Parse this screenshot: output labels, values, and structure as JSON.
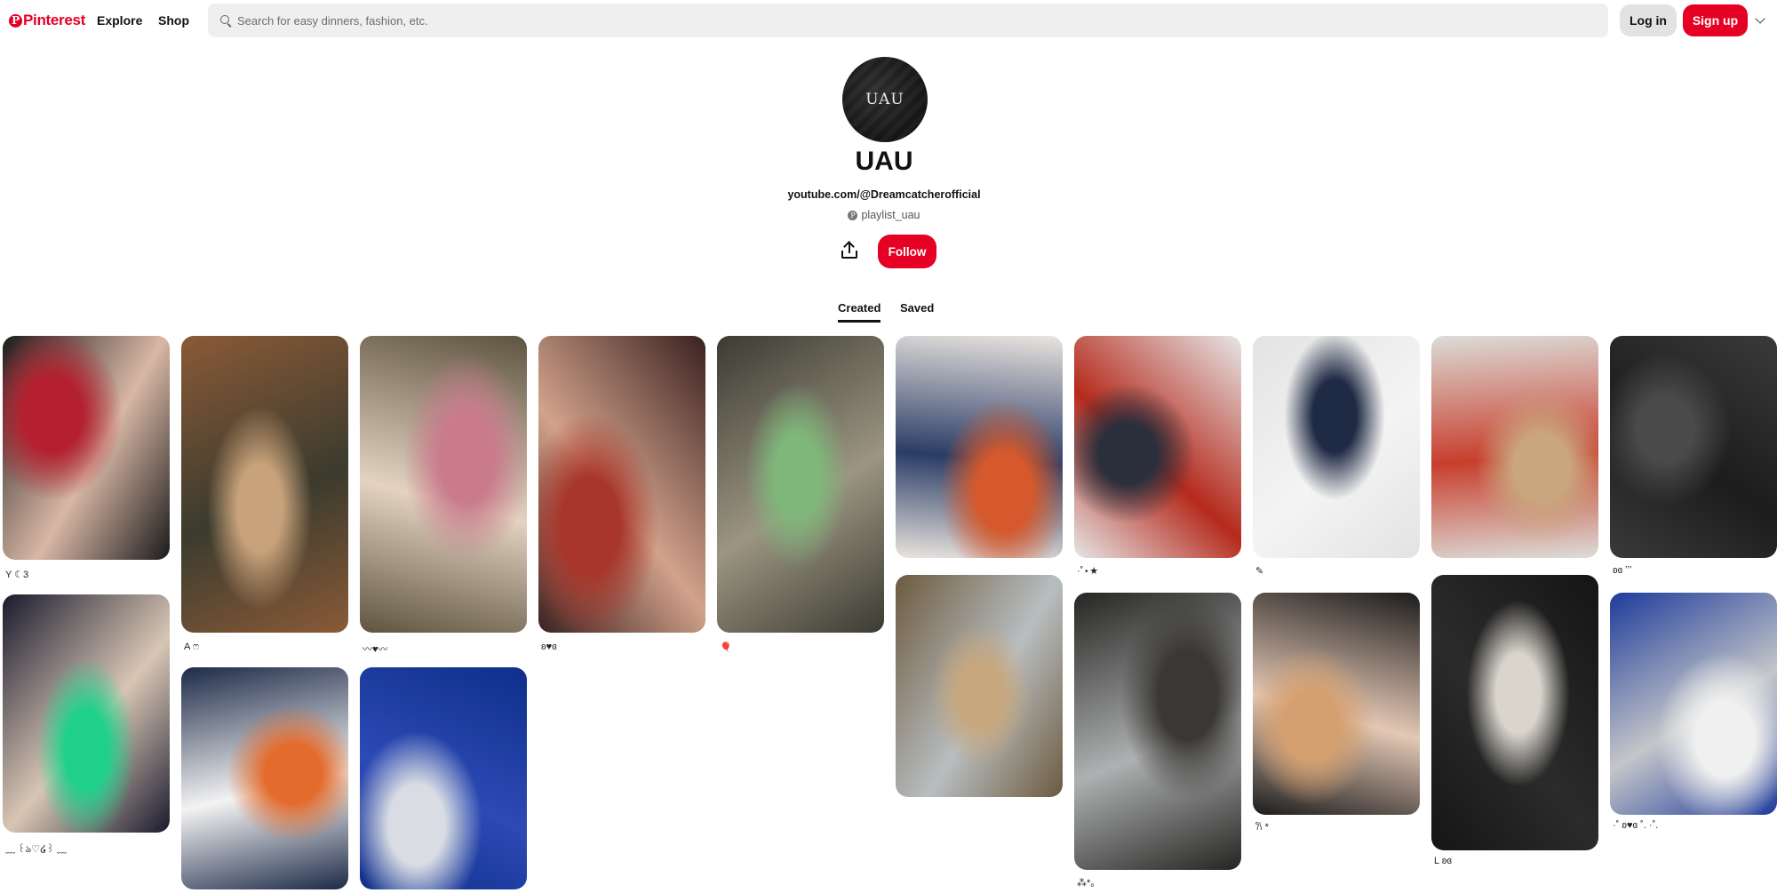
{
  "header": {
    "logo_text": "Pinterest",
    "logo_mark": "P",
    "nav": [
      "Explore",
      "Shop"
    ],
    "search_placeholder": "Search for easy dinners, fashion, etc.",
    "login_label": "Log in",
    "signup_label": "Sign up",
    "brand_color": "#e60023"
  },
  "profile": {
    "avatar_text": "UAU",
    "name": "UAU",
    "website": "youtube.com/@Dreamcatcherofficial",
    "handle": "playlist_uau",
    "follow_label": "Follow"
  },
  "tabs": [
    {
      "label": "Created",
      "active": true
    },
    {
      "label": "Saved",
      "active": false
    }
  ],
  "pins": [
    {
      "caption": "Y ☾3",
      "colors": [
        "#1b1b1b",
        "#b4202f",
        "#d8b7a5"
      ]
    },
    {
      "caption": "A ෆ",
      "colors": [
        "#8a5a37",
        "#c8a27a",
        "#3b3b2e"
      ]
    },
    {
      "caption": "〰♥〰",
      "colors": [
        "#5e5440",
        "#c97b8c",
        "#e3d3c0"
      ]
    },
    {
      "caption": "ʚ♥ɞ",
      "colors": [
        "#3a2120",
        "#a8362b",
        "#d2a28b"
      ]
    },
    {
      "caption": "🎈",
      "colors": [
        "#3c3b33",
        "#7fb77a",
        "#9b9581"
      ]
    },
    {
      "caption": "",
      "colors": [
        "#e9e4df",
        "#d5592c",
        "#2a3c66"
      ]
    },
    {
      "caption": "·˚⋆★",
      "colors": [
        "#e6e6e6",
        "#2b2f3c",
        "#b52a1c"
      ]
    },
    {
      "caption": "✎",
      "colors": [
        "#e3e3e3",
        "#1f2a44",
        "#f4f4f4"
      ]
    },
    {
      "caption": "",
      "colors": [
        "#dcdcd8",
        "#c9a67e",
        "#c83e2c"
      ]
    },
    {
      "caption": "ʚɞ ʼʼʼ",
      "colors": [
        "#3a3a3a",
        "#4a4a4a",
        "#1c1c1c"
      ]
    },
    {
      "caption": "﹏ ꒰ঌ♡໒꒱ ﹏",
      "colors": [
        "#1a1a2e",
        "#1fd08b",
        "#d8c6b4"
      ]
    },
    {
      "caption": "",
      "colors": [
        "#1d2a48",
        "#e36b2d",
        "#f3f3f3"
      ]
    },
    {
      "caption": "",
      "colors": [
        "#0e2f8a",
        "#d9dde3",
        "#2d4ab5"
      ]
    },
    {
      "caption": "",
      "colors": [
        "#6d5a3f",
        "#c7a77d",
        "#b8bec0"
      ]
    },
    {
      "caption": "⁂*。",
      "colors": [
        "#262523",
        "#3a3834",
        "#aeb0b1"
      ]
    },
    {
      "caption": "𐙚 *",
      "colors": [
        "#1c1c1c",
        "#d4a070",
        "#e4c8b5"
      ]
    },
    {
      "caption": "L ʚɞ",
      "colors": [
        "#151515",
        "#d9d5cc",
        "#2b2b2b"
      ]
    },
    {
      "caption": "·˚ ʚ♥ɞ ˚. ·˚.",
      "colors": [
        "#1e3b9a",
        "#f0f0f0",
        "#c4c6c9"
      ]
    }
  ]
}
